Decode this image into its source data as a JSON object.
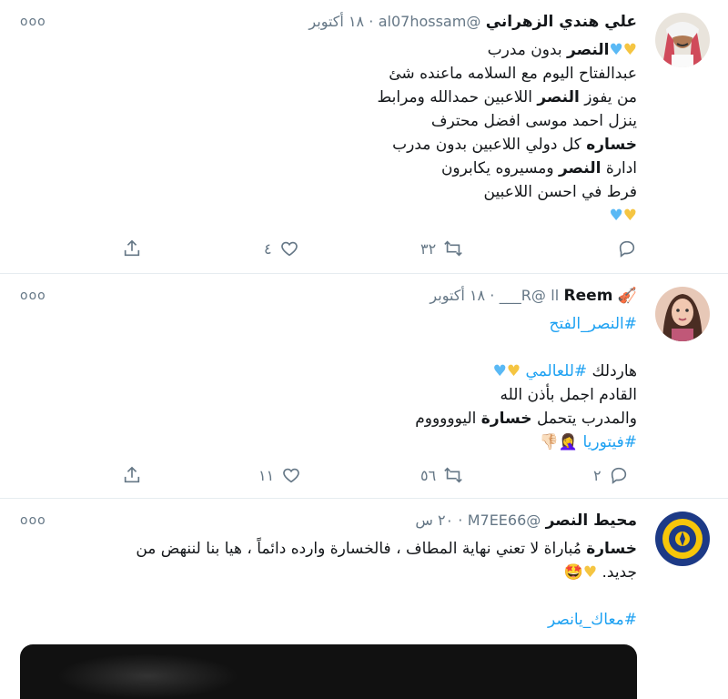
{
  "tweets": [
    {
      "name": "علي هندي الزهراني",
      "handle": "@al07hossam",
      "date": "١٨ أكتوبر",
      "more": "ooo",
      "lines": [
        [
          "",
          "النصر",
          " بدون مدرب"
        ],
        [
          "عبدالفتاح اليوم مع السلامه ماعنده شئ"
        ],
        [
          "من يفوز ",
          "النصر",
          " اللاعبين حمدالله ومرابط"
        ],
        [
          "ينزل احمد موسى افضل محترف"
        ],
        [
          "",
          "خساره",
          " كل دولي اللاعبين بدون مدرب"
        ],
        [
          "ادارة ",
          "النصر",
          " ومسيروه يكابرون"
        ],
        [
          "فرط في احسن اللاعبين"
        ]
      ],
      "actions": {
        "replies": "",
        "retweets": "٣٢",
        "likes": "٤"
      }
    },
    {
      "name": "Reem",
      "name_prefix": "اا",
      "handle": "@R___",
      "date": "١٨ أكتوبر",
      "more": "ooo",
      "hashtag_top": "#النصر_الفتح",
      "line1_text": "هاردلك ",
      "line1_tag": "#للعالمي",
      "line2": "القادم اجمل بأذن الله",
      "line3_a": "والمدرب يتحمل ",
      "line3_b": "خسارة",
      "line3_c": " اليوووووم",
      "line4_tag": "#فيتوريا",
      "actions": {
        "replies": "٢",
        "retweets": "٥٦",
        "likes": "١١"
      }
    },
    {
      "name": "محيط النصر",
      "handle": "@M7EE66",
      "date": "٢٠ س",
      "more": "ooo",
      "line1_bold": "خسارة",
      "line1_rest": " مُباراة لا تعني نهاية المطاف ، فالخسارة وارده دائماً ، هيا بنا لننهض من",
      "line2": "جديد.",
      "hashtag": "#معاك_يانصر"
    }
  ],
  "icons": [
    "reply-icon",
    "retweet-icon",
    "like-icon",
    "share-icon",
    "more-icon"
  ],
  "colors": {
    "link": "#1da1f2",
    "muted": "#657786",
    "border": "#e6ecf0"
  }
}
